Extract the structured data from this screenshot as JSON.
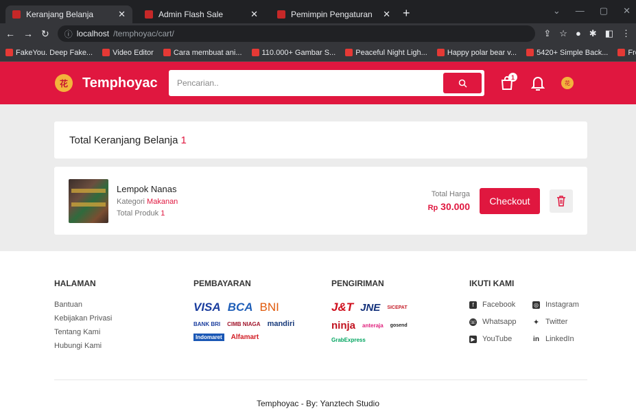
{
  "browser": {
    "tabs": [
      {
        "title": "Keranjang Belanja"
      },
      {
        "title": "Admin Flash Sale"
      },
      {
        "title": "Pemimpin Pengaturan"
      }
    ],
    "url_host": "localhost",
    "url_path": "/temphoyac/cart/",
    "bookmarks": [
      "FakeYou. Deep Fake...",
      "Video Editor",
      "Cara membuat ani...",
      "110.000+ Gambar S...",
      "Peaceful Night Ligh...",
      "Happy polar bear v...",
      "5420+ Simple Back...",
      "Free vector \"Vector..."
    ]
  },
  "header": {
    "brand": "Temphoyac",
    "search_placeholder": "Pencarian..",
    "cart_count": "1"
  },
  "cart": {
    "title": "Total Keranjang Belanja",
    "total_count": "1",
    "item": {
      "name": "Lempok Nanas",
      "category_label": "Kategori",
      "category": "Makanan",
      "qty_label": "Total Produk",
      "qty": "1",
      "price_label": "Total Harga",
      "price_prefix": "Rp",
      "price": "30.000",
      "checkout_label": "Checkout"
    }
  },
  "footer": {
    "halaman": {
      "title": "HALAMAN",
      "links": [
        "Bantuan",
        "Kebijakan Privasi",
        "Tentang Kami",
        "Hubungi Kami"
      ]
    },
    "pembayaran": {
      "title": "PEMBAYARAN",
      "logos": [
        "VISA",
        "BCA",
        "BNI",
        "BANK BRI",
        "CIMB NIAGA",
        "mandiri",
        "Indomaret",
        "Alfamart"
      ]
    },
    "pengiriman": {
      "title": "PENGIRIMAN",
      "logos": [
        "J&T",
        "JNE",
        "SICEPAT",
        "ninja",
        "anteraja",
        "gosend",
        "GrabExpress"
      ]
    },
    "ikuti": {
      "title": "IKUTI KAMI",
      "links": [
        "Facebook",
        "Instagram",
        "Whatsapp",
        "Twitter",
        "YouTube",
        "LinkedIn"
      ]
    },
    "copyright": "Temphoyac - By: Yanztech Studio"
  }
}
